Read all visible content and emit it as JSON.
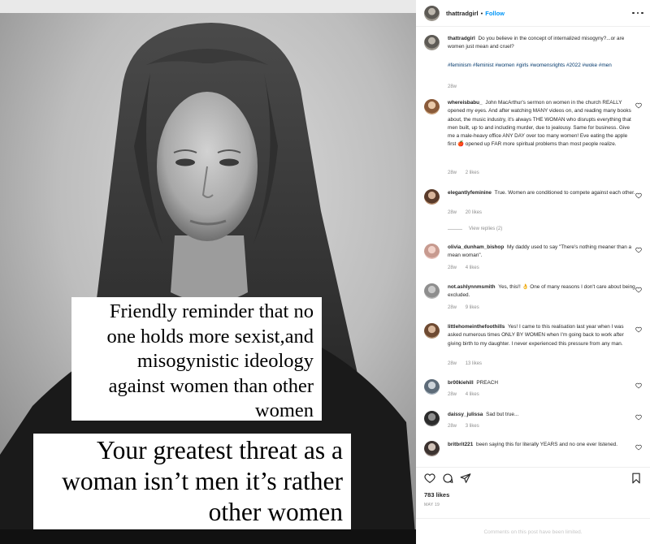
{
  "post": {
    "author": "thattradgirl",
    "separator": "•",
    "follow_label": "Follow",
    "caption_lines": [
      "Friendly reminder that no",
      "one holds more sexist,and",
      "misogynistic ideology",
      "against women than other",
      "women"
    ],
    "caption2_lines": [
      "Your greatest threat as a",
      "woman isn’t men it’s rather",
      "other women"
    ]
  },
  "caption": {
    "user": "thattradgirl",
    "text": "Do you believe in the concept of internalized misogyny?...or are women just mean and cruel?",
    "hashtags": "#feminism #feminist #women #girls #womensrights #2022 #woke #men",
    "time": "28w"
  },
  "comments": [
    {
      "user": "whereisbabu_",
      "text": "John MacArthur's sermon on women in the church REALLY opened my eyes. And after watching MANY videos on, and reading many books about, the music industry, it's always THE WOMAN who disrupts everything that men built, up to and including murder, due to jealousy. Same for business. Give me a male-heavy office ANY DAY over too many women! Eve eating the apple first 🍎 opened up FAR more spiritual problems than most people realize.",
      "time": "28w",
      "likes": "2 likes"
    },
    {
      "user": "elegantlyfeminine",
      "text": "True. Women are conditioned to compete against each other.",
      "time": "28w",
      "likes": "20 likes",
      "replies": "View replies (2)"
    },
    {
      "user": "olivia_dunham_bishop",
      "text": "My daddy used to say \"There's nothing meaner than a mean woman\".",
      "time": "28w",
      "likes": "4 likes"
    },
    {
      "user": "not.ashlynnmsmith",
      "text": "Yes, this!! 👌 One of many reasons I don't care about being excluded.",
      "time": "28w",
      "likes": "9 likes"
    },
    {
      "user": "littlehomeinthefoothills",
      "text": "Yes! I came to this realisation last year when I was asked numerous times ONLY BY WOMEN when I'm going back to work after giving birth to my daughter. I never experienced this pressure from any man.",
      "time": "28w",
      "likes": "13 likes"
    },
    {
      "user": "br00kiehill",
      "text": "PREACH",
      "time": "28w",
      "likes": "4 likes"
    },
    {
      "user": "daissy_julissa",
      "text": "Sad but true...",
      "time": "28w",
      "likes": "3 likes"
    },
    {
      "user": "britbrit221",
      "text": "been saying this for literally YEARS and no one ever listened.",
      "time": "",
      "likes": ""
    }
  ],
  "footer": {
    "likes": "783 likes",
    "date": "MAY 19",
    "limited_notice": "Comments on this post have been limited."
  },
  "icons": {
    "like": "heart-outline-icon",
    "comment": "comment-bubble-icon",
    "share": "paper-plane-icon",
    "save": "bookmark-icon",
    "more": "ellipsis-icon"
  },
  "colors": {
    "follow_blue": "#0095f6",
    "hashtag_navy": "#00376b",
    "muted_gray": "#8e8e8e"
  }
}
